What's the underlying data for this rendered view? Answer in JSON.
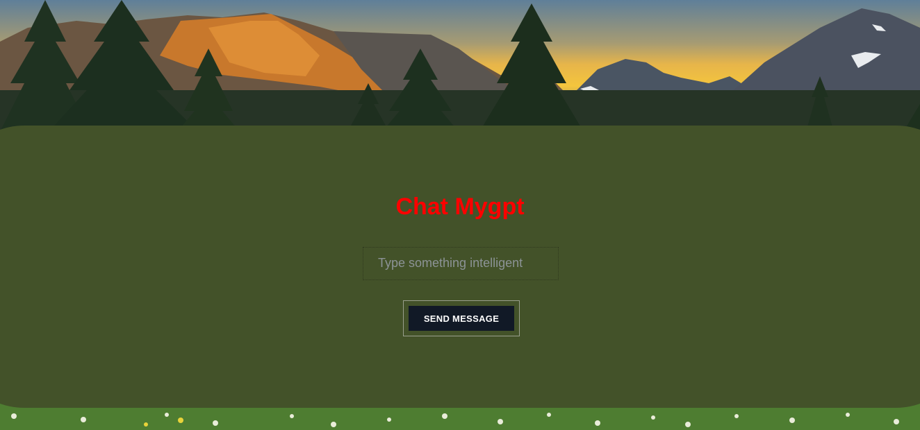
{
  "background": {
    "description_icon": "mountain-landscape-image",
    "panel_color": "#435229"
  },
  "chat": {
    "title": "Chat Mygpt",
    "title_color": "#ff0000",
    "input_placeholder": "Type something intelligent",
    "input_value": "",
    "send_label": "SEND MESSAGE",
    "send_bg": "#111926"
  }
}
